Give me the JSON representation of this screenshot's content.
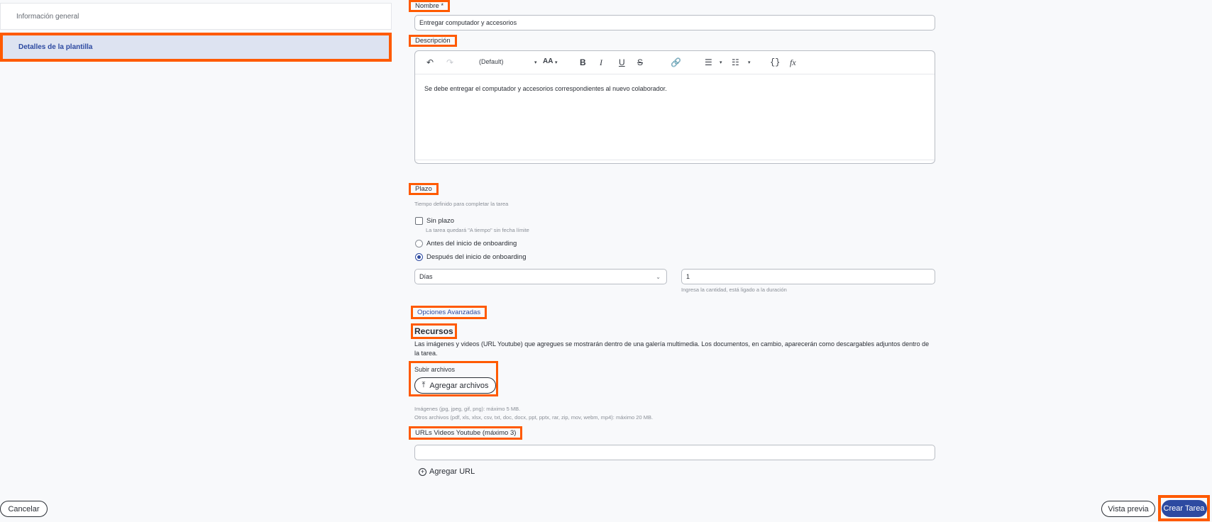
{
  "sidebar": {
    "items": [
      {
        "label": "Información general"
      },
      {
        "label": "Detalles de la plantilla"
      }
    ]
  },
  "form": {
    "nombre_label": "Nombre *",
    "nombre_value": "Entregar computador y accesorios",
    "descripcion_label": "Descripción",
    "editor": {
      "font_select": "(Default)",
      "size_icon": "AA",
      "body_text": "Se debe entregar el computador y accesorios correspondientes al nuevo colaborador."
    },
    "plazo": {
      "label": "Plazo",
      "hint": "Tiempo definido para completar la tarea",
      "sin_plazo_label": "Sin plazo",
      "sin_plazo_hint": "La tarea quedará \"A tiempo\" sin fecha límite",
      "antes_label": "Antes del inicio de onboarding",
      "despues_label": "Después del inicio de onboarding",
      "unit_value": "Días",
      "amount_value": "1",
      "amount_hint": "Ingresa la cantidad, está ligado a la duración"
    },
    "advanced_label": "Opciones Avanzadas",
    "recursos": {
      "title": "Recursos",
      "description": "Las imágenes y videos (URL Youtube) que agregues se mostrarán dentro de una galería multimedia. Los documentos, en cambio, aparecerán como descargables adjuntos dentro de la tarea.",
      "upload_label": "Subir archivos",
      "upload_button": "Agregar archivos",
      "images_hint": "Imágenes (jpg, jpeg, gif, png): máximo 5 MB.",
      "others_hint": "Otros archivos (pdf, xls, xlsx, csv, txt, doc, docx, ppt, pptx, rar, zip, mov, webm, mp4): máximo 20 MB.",
      "youtube_label": "URLs Videos Youtube (máximo 3)",
      "youtube_value": "",
      "add_url": "Agregar URL"
    }
  },
  "footer": {
    "cancel": "Cancelar",
    "preview": "Vista previa",
    "create": "Crear Tarea"
  },
  "colors": {
    "accent": "#2d4aa1",
    "highlight": "#ff5a00"
  }
}
